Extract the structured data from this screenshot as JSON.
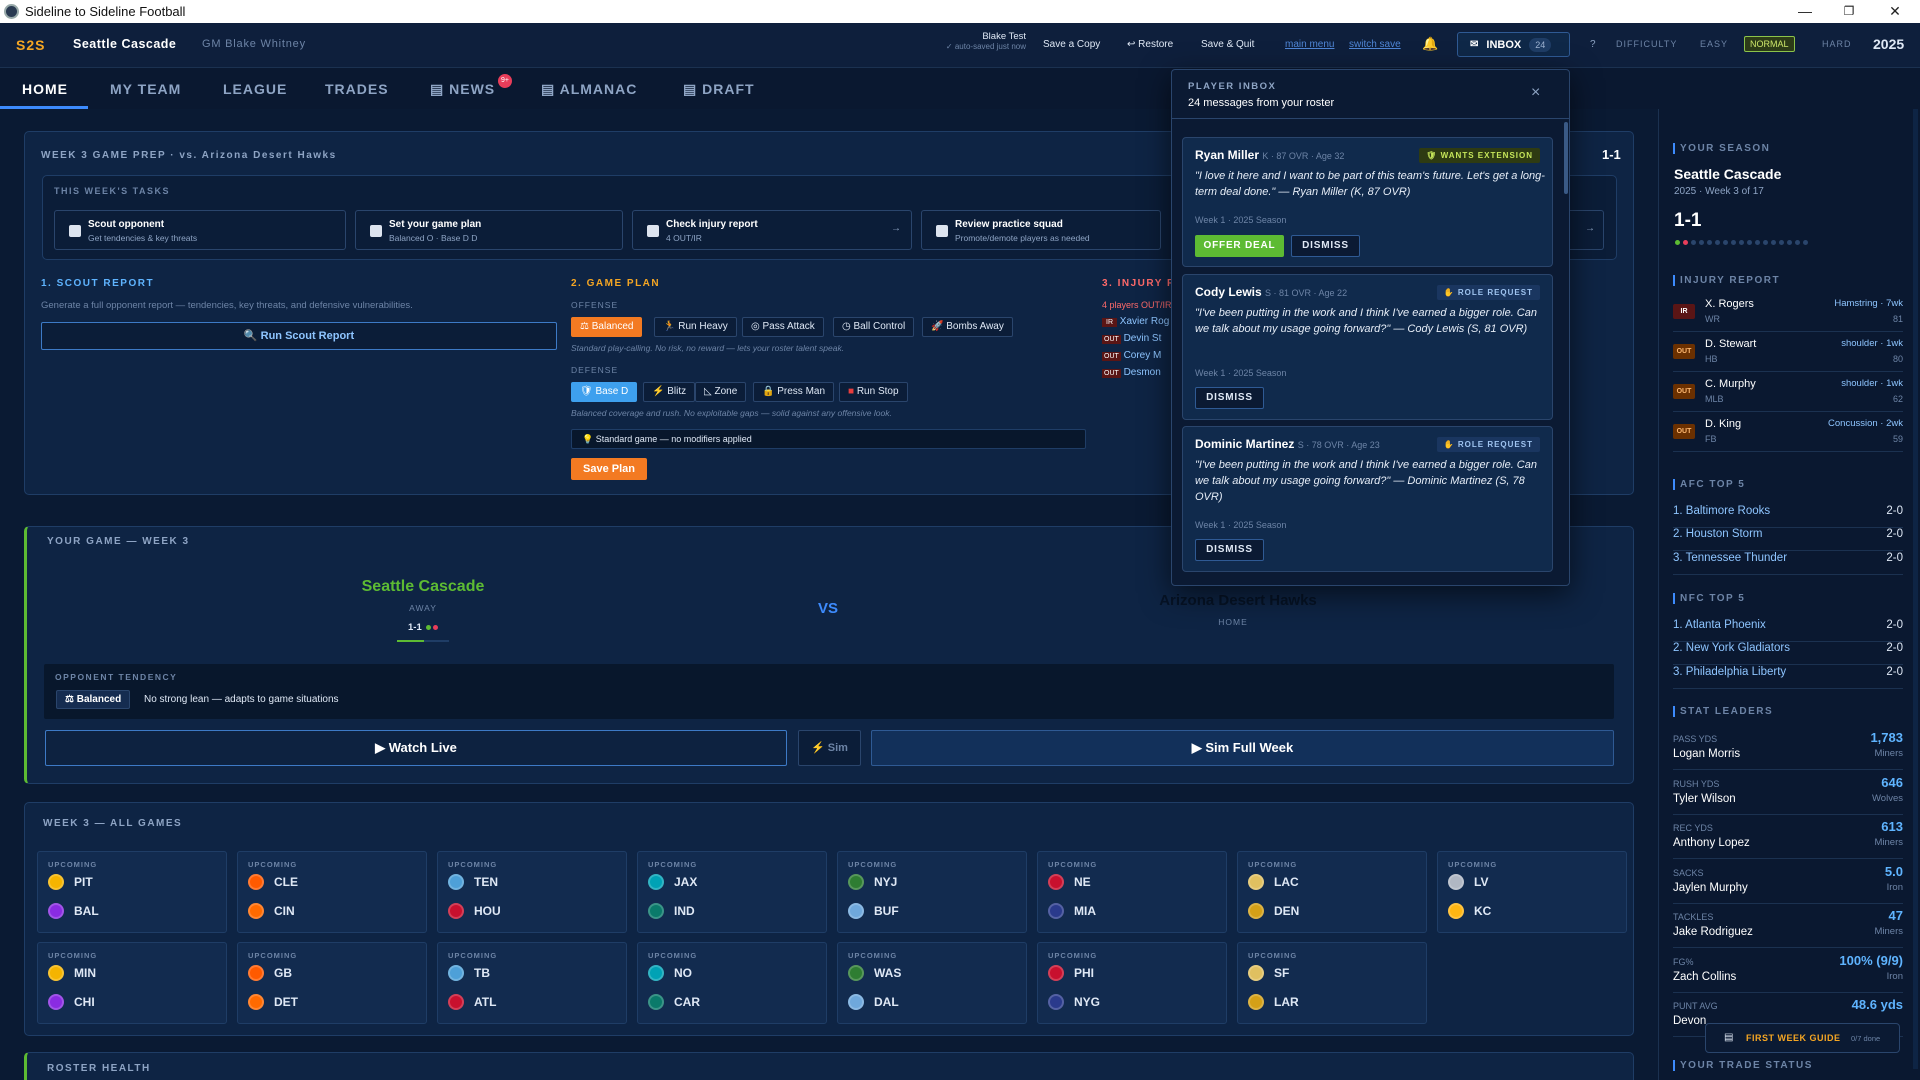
{
  "window": {
    "title": "Sideline to Sideline Football"
  },
  "header": {
    "logo": "S2S",
    "team": "Seattle Cascade",
    "gm": "GM Blake Whitney",
    "user": "Blake Test",
    "autosave": "✓ auto-saved just now",
    "save_copy": "Save a Copy",
    "restore": "↩ Restore",
    "save_quit": "Save & Quit",
    "main_menu": "main menu",
    "switch_save": "switch save",
    "inbox_label": "INBOX",
    "inbox_count": "24",
    "help": "?",
    "difficulty_label": "DIFFICULTY",
    "diff_easy": "EASY",
    "diff_normal": "NORMAL",
    "diff_hard": "HARD",
    "year": "2025"
  },
  "nav": {
    "home": "HOME",
    "my_team": "MY TEAM",
    "league": "LEAGUE",
    "trades": "TRADES",
    "news": "NEWS",
    "news_badge": "9+",
    "almanac": "ALMANAC",
    "draft": "DRAFT"
  },
  "prep": {
    "title": "WEEK 3 GAME PREP · vs. Arizona Desert Hawks",
    "record": "1-1",
    "tasks_title": "THIS WEEK'S TASKS",
    "tasks": [
      {
        "t": "Scout opponent",
        "s": "Get tendencies & key threats"
      },
      {
        "t": "Set your game plan",
        "s": "Balanced O · Base D D"
      },
      {
        "t": "Check injury report",
        "s": "4 OUT/IR",
        "arrow": "→"
      },
      {
        "t": "Review practice squad",
        "s": "Promote/demote players as needed",
        "arrow": "→"
      }
    ],
    "scout_title": "1. SCOUT REPORT",
    "scout_desc": "Generate a full opponent report — tendencies, key threats, and defensive vulnerabilities.",
    "scout_btn": "🔍 Run Scout Report",
    "plan_title": "2. GAME PLAN",
    "offense_label": "OFFENSE",
    "offense": [
      "Balanced",
      "Run Heavy",
      "Pass Attack",
      "Ball Control",
      "Bombs Away"
    ],
    "offense_note": "Standard play-calling. No risk, no reward — lets your roster talent speak.",
    "defense_label": "DEFENSE",
    "defense": [
      "Base D",
      "Blitz",
      "Zone",
      "Press Man",
      "Run Stop"
    ],
    "defense_note": "Balanced coverage and rush. No exploitable gaps — solid against any offensive look.",
    "modifier": "💡 Standard game — no modifiers applied",
    "save_plan": "Save Plan",
    "injury_title": "3. INJURY R",
    "injury_sub": "4 players OUT/IR",
    "injuries": [
      {
        "tag": "IR",
        "name": "Xavier Rog"
      },
      {
        "tag": "OUT",
        "name": "Devin St"
      },
      {
        "tag": "OUT",
        "name": "Corey M"
      },
      {
        "tag": "OUT",
        "name": "Desmon"
      }
    ]
  },
  "game": {
    "title": "YOUR GAME — WEEK 3",
    "home_team": "Seattle Cascade",
    "home_role": "AWAY",
    "home_record": "1-1",
    "vs": "VS",
    "away_team": "Arizona Desert Hawks",
    "away_role": "HOME",
    "tendency_title": "OPPONENT TENDENCY",
    "tendency_chip": "⚖ Balanced",
    "tendency_text": "No strong lean — adapts to game situations",
    "watch": "▶ Watch Live",
    "sim": "⚡ Sim",
    "sim_week": "▶ Sim Full Week"
  },
  "all_games": {
    "title": "WEEK 3 — ALL GAMES",
    "status": "UPCOMING",
    "games": [
      [
        "PIT",
        "BAL"
      ],
      [
        "CLE",
        "CIN"
      ],
      [
        "TEN",
        "HOU"
      ],
      [
        "JAX",
        "IND"
      ],
      [
        "NYJ",
        "BUF"
      ],
      [
        "NE",
        "MIA"
      ],
      [
        "LAC",
        "DEN"
      ],
      [
        "LV",
        "KC"
      ],
      [
        "MIN",
        "CHI"
      ],
      [
        "GB",
        "DET"
      ],
      [
        "TB",
        "ATL"
      ],
      [
        "NO",
        "CAR"
      ],
      [
        "WAS",
        "DAL"
      ],
      [
        "PHI",
        "NYG"
      ],
      [
        "SF",
        "LAR"
      ]
    ]
  },
  "roster_health": {
    "title": "ROSTER HEALTH"
  },
  "inbox": {
    "title": "PLAYER INBOX",
    "sub": "24 messages from your roster",
    "close": "×",
    "messages": [
      {
        "name": "Ryan Miller",
        "meta": "K · 87 OVR · Age 32",
        "tag": "🛡 WANTS EXTENSION",
        "quote": "\"I love it here and I want to be part of this team's future. Let's get a long-term deal done.\" — Ryan Miller (K, 87 OVR)",
        "week": "Week 1 · 2025 Season",
        "offer": "OFFER DEAL",
        "dismiss": "DISMISS"
      },
      {
        "name": "Cody Lewis",
        "meta": "S · 81 OVR · Age 22",
        "tag": "✋ ROLE REQUEST",
        "quote": "\"I've been putting in the work and I think I've earned a bigger role. Can we talk about my usage going forward?\" — Cody Lewis (S, 81 OVR)",
        "week": "Week 1 · 2025 Season",
        "dismiss": "DISMISS"
      },
      {
        "name": "Dominic Martinez",
        "meta": "S · 78 OVR · Age 23",
        "tag": "✋ ROLE REQUEST",
        "quote": "\"I've been putting in the work and I think I've earned a bigger role. Can we talk about my usage going forward?\" — Dominic Martinez (S, 78 OVR)",
        "week": "Week 1 · 2025 Season",
        "dismiss": "DISMISS"
      }
    ]
  },
  "sidebar": {
    "season_title": "YOUR SEASON",
    "team": "Seattle Cascade",
    "week": "2025 · Week 3 of 17",
    "record": "1-1",
    "injury_title": "INJURY REPORT",
    "injuries": [
      {
        "tag": "IR",
        "name": "X. Rogers",
        "pos": "WR",
        "detail": "Hamstring · 7wk",
        "ovr": "81"
      },
      {
        "tag": "OUT",
        "name": "D. Stewart",
        "pos": "HB",
        "detail": "shoulder · 1wk",
        "ovr": "80"
      },
      {
        "tag": "OUT",
        "name": "C. Murphy",
        "pos": "MLB",
        "detail": "shoulder · 1wk",
        "ovr": "62"
      },
      {
        "tag": "OUT",
        "name": "D. King",
        "pos": "FB",
        "detail": "Concussion · 2wk",
        "ovr": "59"
      }
    ],
    "afc_title": "AFC TOP 5",
    "afc": [
      {
        "n": "1. Baltimore Rooks",
        "r": "2-0"
      },
      {
        "n": "2. Houston Storm",
        "r": "2-0"
      },
      {
        "n": "3. Tennessee Thunder",
        "r": "2-0"
      }
    ],
    "nfc_title": "NFC TOP 5",
    "nfc": [
      {
        "n": "1. Atlanta Phoenix",
        "r": "2-0"
      },
      {
        "n": "2. New York Gladiators",
        "r": "2-0"
      },
      {
        "n": "3. Philadelphia Liberty",
        "r": "2-0"
      }
    ],
    "leaders_title": "STAT LEADERS",
    "leaders": [
      {
        "l": "PASS YDS",
        "v": "1,783",
        "n": "Logan Morris",
        "t": "Miners"
      },
      {
        "l": "RUSH YDS",
        "v": "646",
        "n": "Tyler Wilson",
        "t": "Wolves"
      },
      {
        "l": "REC YDS",
        "v": "613",
        "n": "Anthony Lopez",
        "t": "Miners"
      },
      {
        "l": "SACKS",
        "v": "5.0",
        "n": "Jaylen Murphy",
        "t": "Iron"
      },
      {
        "l": "TACKLES",
        "v": "47",
        "n": "Jake Rodriguez",
        "t": "Miners"
      },
      {
        "l": "FG%",
        "v": "100% (9/9)",
        "n": "Zach Collins",
        "t": "Iron"
      },
      {
        "l": "PUNT AVG",
        "v": "48.6 yds",
        "n": "Devon",
        "t": ""
      }
    ],
    "trade_title": "YOUR TRADE STATUS",
    "guide": "FIRST WEEK GUIDE",
    "guide_progress": "0/7 done"
  }
}
